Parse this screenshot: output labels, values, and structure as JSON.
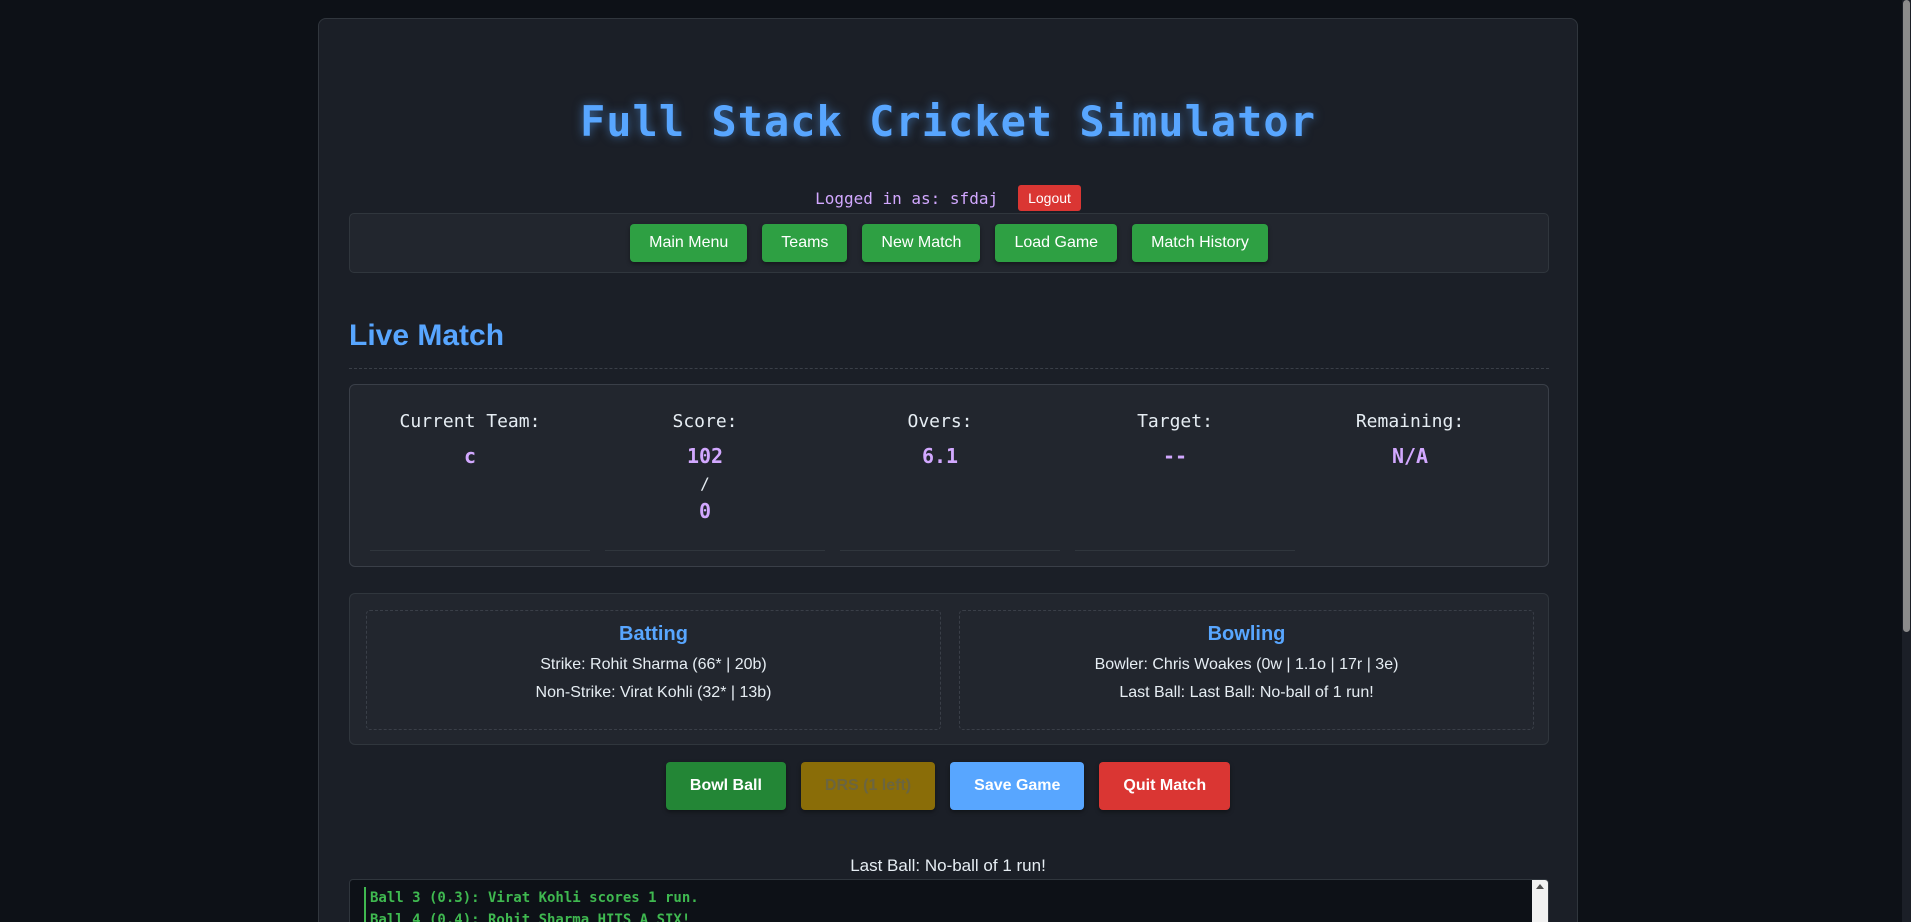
{
  "app": {
    "title": "Full Stack Cricket Simulator"
  },
  "user": {
    "logged_in_text": "Logged in as: sfdaj",
    "logout_label": "Logout"
  },
  "nav": {
    "items": [
      {
        "label": "Main Menu"
      },
      {
        "label": "Teams"
      },
      {
        "label": "New Match"
      },
      {
        "label": "Load Game"
      },
      {
        "label": "Match History"
      }
    ]
  },
  "live_match": {
    "heading": "Live Match",
    "stats": {
      "current_team": {
        "label": "Current Team:",
        "value": "c"
      },
      "score": {
        "label": "Score:",
        "runs": "102",
        "separator": "/",
        "wickets": "0"
      },
      "overs": {
        "label": "Overs:",
        "value": "6.1"
      },
      "target": {
        "label": "Target:",
        "value": "--"
      },
      "remaining": {
        "label": "Remaining:",
        "value": "N/A"
      }
    }
  },
  "batting": {
    "heading": "Batting",
    "strike": "Strike: Rohit Sharma (66* | 20b)",
    "non_strike": "Non-Strike: Virat Kohli (32* | 13b)"
  },
  "bowling": {
    "heading": "Bowling",
    "bowler": "Bowler: Chris Woakes (0w | 1.1o | 17r | 3e)",
    "last_ball": "Last Ball: Last Ball: No-ball of 1 run!"
  },
  "actions": {
    "bowl_label": "Bowl Ball",
    "drs_label": "DRS (1 left)",
    "save_label": "Save Game",
    "quit_label": "Quit Match"
  },
  "status_message": "Last Ball: No-ball of 1 run!",
  "log": [
    "Ball 3 (0.3): Virat Kohli scores 1 run.",
    "Ball 4 (0.4): Rohit Sharma HITS A SIX!"
  ],
  "colors": {
    "background": "#0d1117",
    "accent_blue": "#58a6ff",
    "accent_green": "#2ea043",
    "accent_red": "#da3633",
    "accent_purple": "#d2a8ff",
    "log_green": "#3fb950"
  }
}
